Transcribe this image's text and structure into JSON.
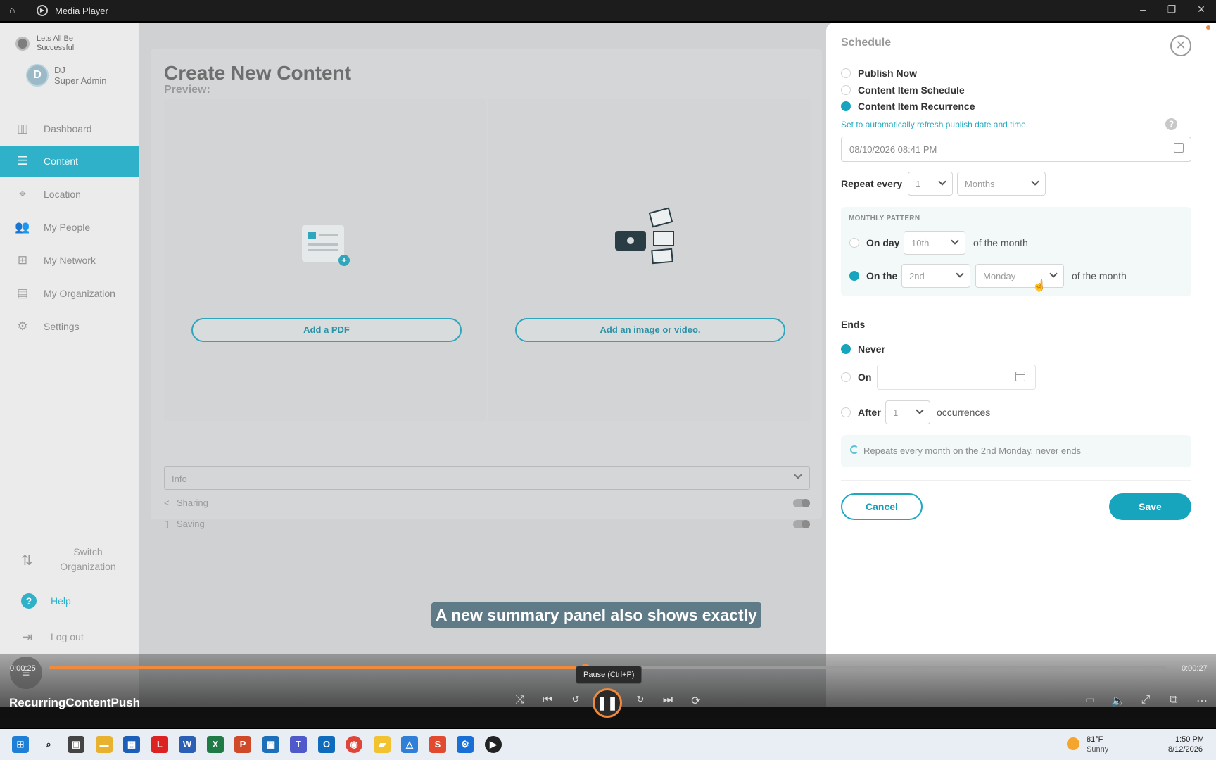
{
  "window": {
    "title": "Media Player"
  },
  "sidebar": {
    "org_name": "Lets All Be Successful",
    "user_initial": "D",
    "user_name": "DJ",
    "user_role": "Super Admin",
    "items": [
      {
        "label": "Dashboard",
        "icon": "chart-icon"
      },
      {
        "label": "Content",
        "icon": "content-icon"
      },
      {
        "label": "Location",
        "icon": "pin-icon"
      },
      {
        "label": "My People",
        "icon": "people-icon"
      },
      {
        "label": "My Network",
        "icon": "network-icon"
      },
      {
        "label": "My Organization",
        "icon": "building-icon"
      },
      {
        "label": "Settings",
        "icon": "gear-icon"
      }
    ],
    "switch_org": "Switch Organization",
    "help": "Help",
    "logout": "Log out"
  },
  "main": {
    "title": "Create New Content",
    "preview_label": "Preview:",
    "add_pdf": "Add a PDF",
    "add_media": "Add an image or video.",
    "info_label": "Info",
    "sharing_label": "Sharing",
    "saving_label": "Saving"
  },
  "schedule": {
    "title": "Schedule",
    "options": [
      "Publish Now",
      "Content Item Schedule",
      "Content Item Recurrence"
    ],
    "selected_option": "Content Item Recurrence",
    "hint": "Set to automatically refresh publish date and time.",
    "datetime": "08/10/2026 08:41 PM",
    "repeat_label": "Repeat every",
    "repeat_count": "1",
    "repeat_unit": "Months",
    "monthly_pattern_title": "MONTHLY PATTERN",
    "on_day_label": "On day",
    "on_day_value": "10th",
    "of_the_month": "of the month",
    "on_the_label": "On the",
    "on_the_ordinal": "2nd",
    "on_the_weekday": "Monday",
    "ends_title": "Ends",
    "ends_never": "Never",
    "ends_on": "On",
    "ends_after": "After",
    "ends_after_count": "1",
    "occurrences": "occurrences",
    "summary": "Repeats every month on the 2nd Monday, never ends",
    "cancel": "Cancel",
    "save": "Save"
  },
  "caption": "A new summary panel also shows exactly",
  "player": {
    "elapsed": "0:00:25",
    "total": "0:00:27",
    "progress": 0.48,
    "tooltip": "Pause (Ctrl+P)",
    "media_title": "RecurringContentPush"
  },
  "taskbar": {
    "weather_temp": "81°F",
    "weather_desc": "Sunny",
    "time": "1:50 PM",
    "date": "8/12/2026"
  },
  "colors": {
    "accent": "#17a4bd",
    "progress": "#f08a3c"
  }
}
